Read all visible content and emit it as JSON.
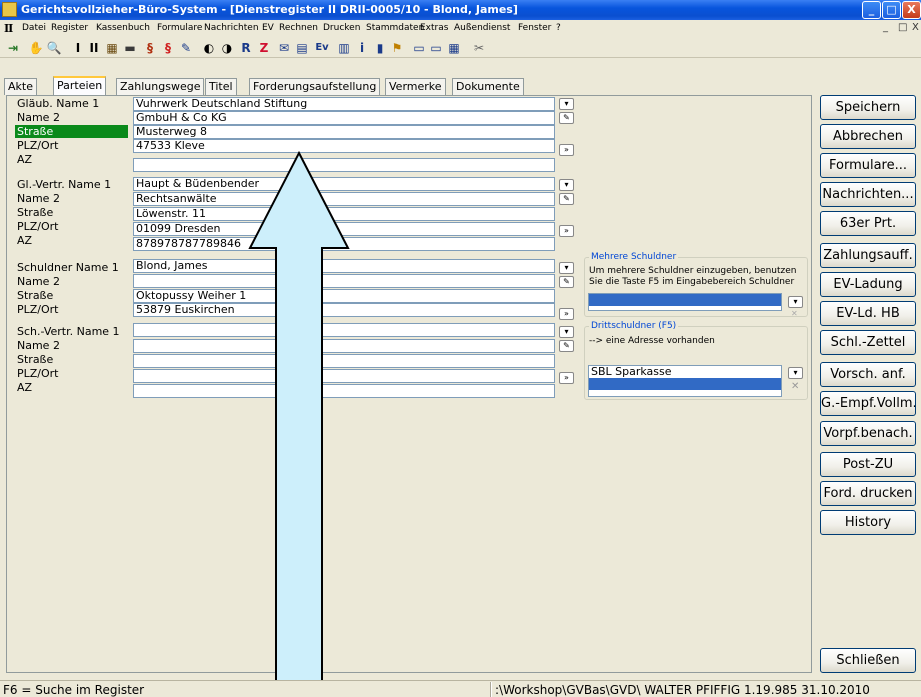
{
  "window": {
    "title": "Gerichtsvollzieher-Büro-System - [Dienstregister II DRII-0005/10 - Blond, James]",
    "controls": [
      "_",
      "□",
      "X"
    ]
  },
  "menu": {
    "mdi_icon": "II",
    "items": [
      "Datei",
      "Register",
      "Kassenbuch",
      "Formulare",
      "Nachrichten",
      "EV",
      "Rechnen",
      "Drucken",
      "Stammdaten",
      "Extras",
      "Außendienst",
      "Fenster",
      "?"
    ],
    "mdi_controls": [
      "_",
      "□",
      "X"
    ]
  },
  "toolbar": {
    "icons": [
      "door-icon",
      "stamp-icon",
      "preview-icon",
      "roman-one-icon",
      "roman-two-icon",
      "calculator-icon",
      "folder-icon",
      "paragraph-icon",
      "paragraph-red-icon",
      "signature-icon",
      "clock-icon",
      "clock-two-icon",
      "r-icon",
      "z-icon",
      "mail-icon",
      "register-icon",
      "ev-icon",
      "book-icon",
      "info-icon",
      "trash-icon",
      "flag-icon",
      "card-icon",
      "card-two-icon",
      "card-three-icon",
      "tools-icon"
    ],
    "glyphs": [
      "⇥",
      "✋",
      "🔍",
      "I",
      "II",
      "▦",
      "▬",
      "§",
      "§",
      "✎",
      "◐",
      "◑",
      "R",
      "Z",
      "✉",
      "▤",
      "Ev",
      "▥",
      "i",
      "▮",
      "⚑",
      "▭",
      "▭",
      "▦",
      "✂"
    ]
  },
  "tabs": [
    "Akte",
    "Parteien",
    "Zahlungswege",
    "Titel",
    "Forderungsaufstellung",
    "Vermerke",
    "Dokumente"
  ],
  "active_tab": "Parteien",
  "creditor": {
    "labels": [
      "Gläub. Name 1",
      "Name 2",
      "Straße",
      "PLZ/Ort",
      "AZ"
    ],
    "values": [
      "Vuhrwerk Deutschland Stiftung",
      "GmbuH & Co KG",
      "Musterweg 8",
      "47533 Kleve",
      ""
    ]
  },
  "creditor_rep": {
    "labels": [
      "Gl.-Vertr. Name 1",
      "Name 2",
      "Straße",
      "PLZ/Ort",
      "AZ"
    ],
    "values": [
      "Haupt & Büdenbender",
      "Rechtsanwälte",
      "Löwenstr. 11",
      "01099 Dresden",
      "878978787789846"
    ]
  },
  "debtor": {
    "labels": [
      "Schuldner Name 1",
      "Name 2",
      "Straße",
      "PLZ/Ort"
    ],
    "values": [
      "Blond, James",
      "",
      "Oktopussy Weiher 1",
      "53879 Euskirchen"
    ]
  },
  "debtor_rep": {
    "labels": [
      "Sch.-Vertr. Name 1",
      "Name 2",
      "Straße",
      "PLZ/Ort",
      "AZ"
    ],
    "values": [
      "",
      "",
      "",
      "",
      ""
    ]
  },
  "multi_debtor": {
    "legend": "Mehrere Schuldner",
    "note": "Um mehrere Schuldner einzugeben, benutzen Sie die Taste F5 im Eingabebereich Schuldner"
  },
  "third_debtor": {
    "legend": "Drittschuldner (F5)",
    "note": "--> eine Adresse vorhanden",
    "items": [
      "SBL Sparkasse"
    ]
  },
  "side_buttons": [
    "Speichern",
    "Abbrechen",
    "Formulare...",
    "Nachrichten...",
    "63er Prt.",
    "Zahlungsauff.",
    "EV-Ladung",
    "EV-Ld. HB",
    "Schl.-Zettel",
    "Vorsch. anf.",
    "G.-Empf.Vollm.",
    "Vorpf.benach.",
    "Post-ZU",
    "Ford. drucken",
    "History"
  ],
  "close_button": "Schließen",
  "status": {
    "left": "F6 = Suche im Register",
    "right": ":\\Workshop\\GVBas\\GVD\\ WALTER PFIFFIG 1.19.985 31.10.2010"
  },
  "colors": {
    "highlight_label": "#0a8a1a",
    "selection": "#316ac5",
    "accent_blue": "#0046d5"
  }
}
